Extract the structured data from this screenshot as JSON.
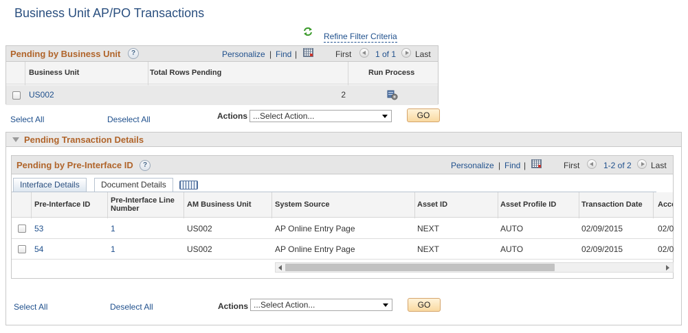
{
  "page_title": "Business Unit AP/PO Transactions",
  "refine_filter": "Refine Filter Criteria",
  "bu_grid": {
    "title": "Pending by Business Unit",
    "personalize": "Personalize",
    "find": "Find",
    "first": "First",
    "range": "1 of 1",
    "last": "Last",
    "columns": [
      "Business Unit",
      "Total Rows Pending",
      "Run Process"
    ],
    "rows": [
      {
        "business_unit": "US002",
        "total_rows_pending": "2"
      }
    ]
  },
  "select_all": "Select All",
  "deselect_all": "Deselect All",
  "actions_label": "Actions",
  "action_select_value": "...Select Action...",
  "go_label": "GO",
  "details_section": {
    "title": "Pending Transaction Details"
  },
  "pre_grid": {
    "title": "Pending by Pre-Interface ID",
    "personalize": "Personalize",
    "find": "Find",
    "first": "First",
    "range": "1-2 of 2",
    "last": "Last",
    "tabs": [
      "Interface Details",
      "Document Details"
    ],
    "columns": [
      "Pre-Interface ID",
      "Pre-Interface Line Number",
      "AM Business Unit",
      "System Source",
      "Asset ID",
      "Asset Profile ID",
      "Transaction Date",
      "Acco"
    ],
    "rows": [
      {
        "id": "53",
        "line": "1",
        "am_bu": "US002",
        "source": "AP Online Entry Page",
        "asset_id": "NEXT",
        "profile": "AUTO",
        "date": "02/09/2015",
        "acct": "02/0"
      },
      {
        "id": "54",
        "line": "1",
        "am_bu": "US002",
        "source": "AP Online Entry Page",
        "asset_id": "NEXT",
        "profile": "AUTO",
        "date": "02/09/2015",
        "acct": "02/0"
      }
    ]
  }
}
